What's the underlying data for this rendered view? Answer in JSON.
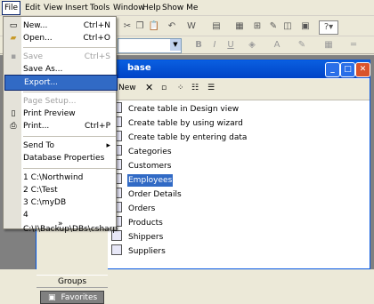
{
  "menubar": [
    "File",
    "Edit",
    "View",
    "Insert",
    "Tools",
    "Window",
    "Help",
    "Show Me"
  ],
  "file_menu": [
    {
      "label": "New...",
      "shortcut": "Ctrl+N",
      "icon": "new-doc-icon",
      "disabled": false
    },
    {
      "label": "Open...",
      "shortcut": "Ctrl+O",
      "icon": "open-folder-icon",
      "disabled": false
    },
    {
      "label": "Save",
      "shortcut": "Ctrl+S",
      "icon": "save-icon",
      "disabled": true
    },
    {
      "label": "Save As...",
      "shortcut": "",
      "icon": "",
      "disabled": false
    },
    {
      "label": "Export...",
      "shortcut": "",
      "icon": "",
      "disabled": false,
      "highlighted": true
    },
    {
      "label": "Page Setup...",
      "shortcut": "",
      "icon": "",
      "disabled": true
    },
    {
      "label": "Print Preview",
      "shortcut": "",
      "icon": "print-preview-icon",
      "disabled": false
    },
    {
      "label": "Print...",
      "shortcut": "Ctrl+P",
      "icon": "print-icon",
      "disabled": false
    },
    {
      "label": "Send To",
      "shortcut": "",
      "icon": "",
      "disabled": false,
      "submenu": true
    },
    {
      "label": "Database Properties",
      "shortcut": "",
      "icon": "",
      "disabled": false
    },
    {
      "label": "1 C:\\Northwind",
      "shortcut": "",
      "icon": "",
      "disabled": false
    },
    {
      "label": "2 C:\\Test",
      "shortcut": "",
      "icon": "",
      "disabled": false
    },
    {
      "label": "3 C:\\myDB",
      "shortcut": "",
      "icon": "",
      "disabled": false
    },
    {
      "label": "4 C:\\!\\Backup\\DBs\\csharp",
      "shortcut": "",
      "icon": "",
      "disabled": false
    }
  ],
  "file_menu_expand_glyph": "»",
  "submenu_arrow": "▸",
  "db_window": {
    "title_fragment": "base",
    "toolbar_new": "New",
    "objects": [
      {
        "label": "Create table in Design view",
        "selected": false
      },
      {
        "label": "Create table by using wizard",
        "selected": false
      },
      {
        "label": "Create table by entering data",
        "selected": false
      },
      {
        "label": "Categories",
        "selected": false
      },
      {
        "label": "Customers",
        "selected": false
      },
      {
        "label": "Employees",
        "selected": true
      },
      {
        "label": "Order Details",
        "selected": false
      },
      {
        "label": "Orders",
        "selected": false
      },
      {
        "label": "Products",
        "selected": false
      },
      {
        "label": "Shippers",
        "selected": false
      },
      {
        "label": "Suppliers",
        "selected": false
      }
    ],
    "groups_label": "Groups",
    "favorites_label": "Favorites"
  },
  "toolbar2_font_buttons": [
    "B",
    "I",
    "U"
  ],
  "colors": {
    "accent": "#316ac5",
    "titlebar": "#0a5fe0",
    "menu_bg": "#ece9d8"
  }
}
